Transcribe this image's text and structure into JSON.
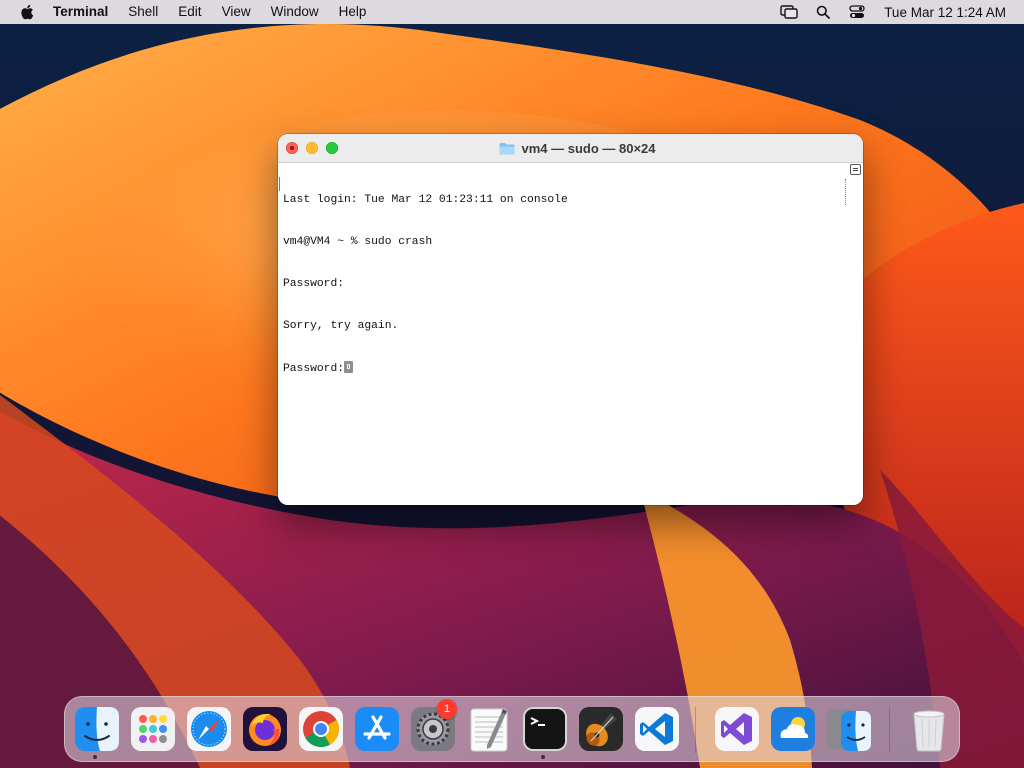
{
  "menubar": {
    "app_name": "Terminal",
    "menus": [
      "Shell",
      "Edit",
      "View",
      "Window",
      "Help"
    ],
    "clock": "Tue Mar 12  1:24 AM",
    "status_icons": [
      "screen-mirroring-icon",
      "search-icon",
      "control-center-icon"
    ]
  },
  "window": {
    "title": "vm4 — sudo — 80×24",
    "lines": [
      "Last login: Tue Mar 12 01:23:11 on console",
      "vm4@VM4 ~ % sudo crash",
      "Password:",
      "Sorry, try again.",
      "Password:"
    ]
  },
  "dock": {
    "apps": [
      {
        "name": "finder",
        "icon": "finder-icon",
        "running": true
      },
      {
        "name": "launchpad",
        "icon": "launchpad-icon",
        "running": false
      },
      {
        "name": "safari",
        "icon": "safari-icon",
        "running": false
      },
      {
        "name": "firefox",
        "icon": "firefox-icon",
        "running": false
      },
      {
        "name": "chrome",
        "icon": "chrome-icon",
        "running": false
      },
      {
        "name": "app-store",
        "icon": "app-store-icon",
        "running": false
      },
      {
        "name": "system-settings",
        "icon": "gear-icon",
        "running": false,
        "badge": "1"
      },
      {
        "name": "textedit",
        "icon": "textedit-icon",
        "running": false
      },
      {
        "name": "terminal",
        "icon": "terminal-icon",
        "running": true
      },
      {
        "name": "garageband",
        "icon": "guitar-icon",
        "running": false
      },
      {
        "name": "vscode",
        "icon": "vscode-icon",
        "running": false
      },
      {
        "name": "visual-studio",
        "icon": "visual-studio-icon",
        "running": false
      },
      {
        "name": "weather",
        "icon": "weather-icon",
        "running": false
      },
      {
        "name": "migration-assistant",
        "icon": "migration-assistant-icon",
        "running": false
      },
      {
        "name": "trash",
        "icon": "trash-icon",
        "running": false
      }
    ]
  }
}
